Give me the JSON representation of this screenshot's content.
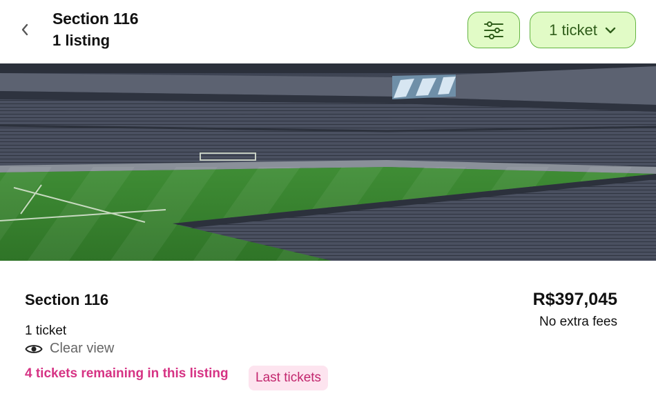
{
  "header": {
    "title": "Section 116",
    "subtitle": "1 listing",
    "ticket_selector_label": "1 ticket"
  },
  "listing": {
    "section": "Section 116",
    "ticket_count": "1 ticket",
    "view_label": "Clear view",
    "remaining_text": "4 tickets remaining in this listing",
    "badge": "Last tickets",
    "price": "R$397,045",
    "fees_note": "No extra fees"
  },
  "icons": {
    "back": "chevron-left-icon",
    "filter": "sliders-icon",
    "dropdown": "chevron-down-icon",
    "view": "eye-icon"
  },
  "colors": {
    "button_bg": "#e1fbc6",
    "button_border": "#62b33f",
    "remaining_text": "#d63384",
    "badge_bg": "#fde4ef"
  }
}
